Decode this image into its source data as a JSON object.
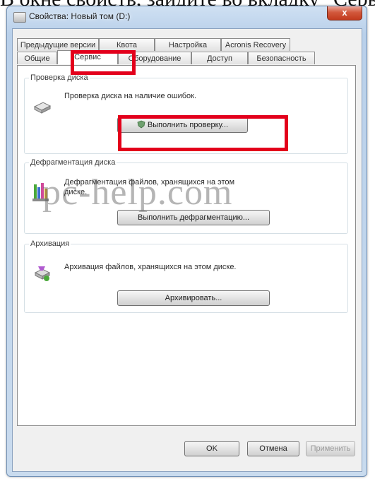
{
  "caption": "В окне свойств, зайдите во вкладку \"Сервис\"",
  "window": {
    "title": "Свойства: Новый том (D:)",
    "close_label": "x"
  },
  "tabs": {
    "back_row": [
      "Предыдущие версии",
      "Квота",
      "Настройка",
      "Acronis Recovery"
    ],
    "front_row": [
      "Общие",
      "Сервис",
      "Оборудование",
      "Доступ",
      "Безопасность"
    ],
    "active": "Сервис"
  },
  "groups": {
    "check": {
      "title": "Проверка диска",
      "description": "Проверка диска на наличие ошибок.",
      "button": "Выполнить проверку..."
    },
    "defrag": {
      "title": "Дефрагментация диска",
      "description": "Дефрагментация файлов, хранящихся на этом диске.",
      "button": "Выполнить дефрагментацию..."
    },
    "archive": {
      "title": "Архивация",
      "description": "Архивация файлов, хранящихся на этом диске.",
      "button": "Архивировать..."
    }
  },
  "footer": {
    "ok": "OK",
    "cancel": "Отмена",
    "apply": "Применить"
  },
  "watermark": "pc-help.com",
  "colors": {
    "highlight": "#e3001b",
    "titlebar": "#b9d0ea",
    "close": "#c23a1d"
  }
}
